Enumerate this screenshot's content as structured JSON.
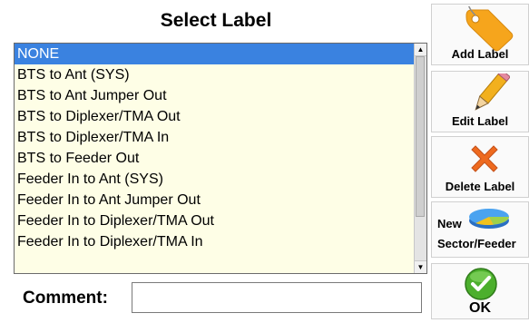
{
  "title": "Select Label",
  "list": {
    "items": [
      "NONE",
      "BTS to Ant (SYS)",
      "BTS to Ant Jumper Out",
      "BTS to Diplexer/TMA Out",
      "BTS to Diplexer/TMA In",
      "BTS to Feeder Out",
      "Feeder In to Ant (SYS)",
      "Feeder In to Ant Jumper Out",
      "Feeder In to Diplexer/TMA Out",
      "Feeder In to Diplexer/TMA In"
    ],
    "selected_index": 0
  },
  "comment": {
    "label": "Comment:",
    "value": ""
  },
  "buttons": {
    "add": "Add Label",
    "edit": "Edit Label",
    "delete": "Delete Label",
    "new_line1": "New",
    "new_line2": "Sector/Feeder",
    "ok": "OK"
  },
  "colors": {
    "selection": "#3a82e0",
    "list_background": "#fefee6",
    "tag": "#f6a51c",
    "delete_x": "#ee6a1f",
    "ok_check": "#4caf2d"
  }
}
